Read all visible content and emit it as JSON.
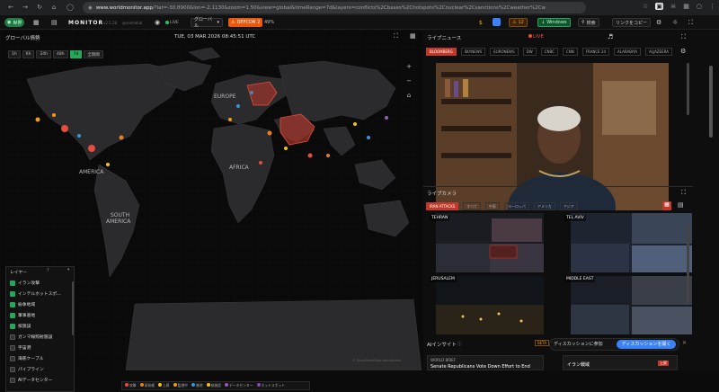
{
  "browser": {
    "url_host": "www.worldmonitor.app",
    "url_rest": "/?lat=-30.8900&lon=-2.1130&zoom=1.50&view=global&timeRange=7d&layers=conflicts%2Cbases%2Chotspots%2Cnuclear%2Csanctions%2Cweather%2Cw"
  },
  "app": {
    "brand": "MONITOR",
    "version": "v2.5.28",
    "handle": "@eliehabib",
    "live": "LIVE",
    "region": "グローバル",
    "defcon": "DEFCON 2",
    "defcon_pct": "49%",
    "windows": "Windows",
    "search": "検索",
    "copy_link": "リンクをコピー",
    "count": "12",
    "world_label": "世界"
  },
  "map": {
    "title": "グローバル情勢",
    "time": "TUE, 03 MAR 2026 08:45:51 UTC",
    "ranges": [
      "1h",
      "6h",
      "24h",
      "48h",
      "7d",
      "全期間"
    ],
    "active_range": "7d",
    "labels": {
      "europe": "EUROPE",
      "africa": "AFRICA",
      "america": "AMERICA",
      "south": "SOUTH",
      "south2": "AMERICA"
    },
    "credit": "© OpenStreetMap contributors"
  },
  "layers": {
    "title": "レイヤー",
    "help": "?",
    "items": [
      {
        "label": "イラン攻撃",
        "on": true,
        "color": "#22a85a"
      },
      {
        "label": "インテルホットスポ...",
        "on": true,
        "color": "#22a85a"
      },
      {
        "label": "紛争地域",
        "on": true,
        "color": "#22a85a"
      },
      {
        "label": "軍事基地",
        "on": true,
        "color": "#22a85a"
      },
      {
        "label": "核施設",
        "on": true,
        "color": "#22a85a"
      },
      {
        "label": "ガンマ線照射施設",
        "on": false,
        "color": "#333"
      },
      {
        "label": "宇宙港",
        "on": false,
        "color": "#333"
      },
      {
        "label": "海底ケーブル",
        "on": false,
        "color": "#333"
      },
      {
        "label": "パイプライン",
        "on": false,
        "color": "#333"
      },
      {
        "label": "AIデータセンター",
        "on": false,
        "color": "#333"
      }
    ]
  },
  "legend": [
    {
      "label": "攻撃",
      "color": "#e74c3c"
    },
    {
      "label": "高脅威",
      "color": "#e67e22"
    },
    {
      "label": "上昇",
      "color": "#f1c40f"
    },
    {
      "label": "監視中",
      "color": "#f39c12"
    },
    {
      "label": "基地",
      "color": "#3498db"
    },
    {
      "label": "核施設",
      "color": "#f1c40f"
    },
    {
      "label": "データセンター",
      "color": "#9b59b6"
    },
    {
      "label": "ホットスポット",
      "color": "#8e44ad"
    }
  ],
  "news": {
    "title": "ライブニュース",
    "live": "LIVE",
    "channels": [
      "BLOOMBERG",
      "SKYNEWS",
      "EURONEWS",
      "DW",
      "CNBC",
      "CNN",
      "FRANCE 24",
      "ALARABIYA",
      "ALJAZEERA"
    ],
    "active": "BLOOMBERG"
  },
  "cams": {
    "title": "ライブカメラ",
    "filters": [
      "IRAN ATTACKS",
      "すべて",
      "中東",
      "ヨーロッパ",
      "アメリカ",
      "アジア"
    ],
    "active": "IRAN ATTACKS",
    "feeds": [
      "TEHRAN",
      "TEL AVIV",
      "JERUSALEM",
      "MIDDLE EAST"
    ]
  },
  "ai": {
    "title": "AIインサイト",
    "badge": "BETA",
    "world_brief": "WORLD BRIEF",
    "headline": "Senate Republicans Vote Down Effort to End",
    "side_title": "イラン戦域",
    "side_badge": "上昇"
  },
  "discussion": {
    "prompt": "ディスカッションに参加",
    "button": "ディスカッションを開く"
  }
}
